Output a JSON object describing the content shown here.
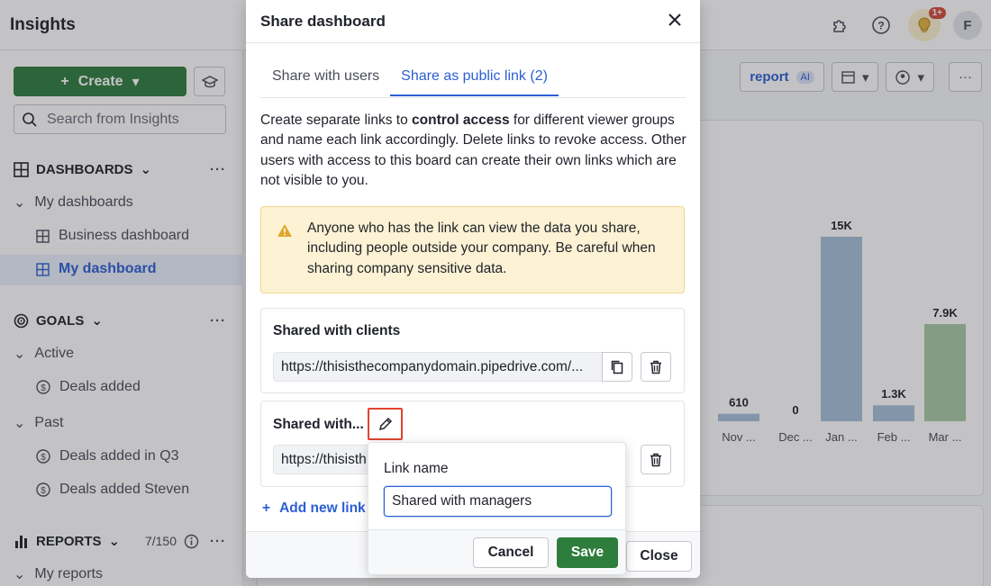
{
  "app": {
    "title": "Insights",
    "notification_badge": "1+",
    "user_initial": "F"
  },
  "sidebar": {
    "create_label": "Create",
    "search_placeholder": "Search from Insights",
    "dashboards": {
      "title": "DASHBOARDS",
      "group": "My dashboards",
      "items": [
        "Business dashboard",
        "My dashboard"
      ]
    },
    "goals": {
      "title": "GOALS",
      "active_group": "Active",
      "active_items": [
        "Deals added"
      ],
      "past_group": "Past",
      "past_items": [
        "Deals added in Q3",
        "Deals added Steven"
      ]
    },
    "reports": {
      "title": "REPORTS",
      "count": "7/150",
      "group": "My reports"
    }
  },
  "toolbar": {
    "report_label": "report",
    "ai_badge": "AI"
  },
  "chart_data": {
    "type": "bar",
    "categories": [
      "Nov ...",
      "Dec ...",
      "Jan ...",
      "Feb ...",
      "Mar ..."
    ],
    "values": [
      610,
      0,
      15000,
      1300,
      7900
    ],
    "data_labels": [
      "610",
      "0",
      "15K",
      "1.3K",
      "7.9K"
    ],
    "colors": [
      "#a7c0d9",
      "#a7c0d9",
      "#a7c0d9",
      "#a7c0d9",
      "#a9c9a6"
    ]
  },
  "modal": {
    "title": "Share dashboard",
    "tabs": [
      "Share with users",
      "Share as public link (2)"
    ],
    "description_parts": [
      "Create separate links to ",
      "control access",
      " for different viewer groups and name each link accordingly. Delete links to revoke access. Other users with access to this board can create their own links which are not visible to you."
    ],
    "warning": "Anyone who has the link can view the data you share, including people outside your company. Be careful when sharing company sensitive data.",
    "links": [
      {
        "name": "Shared with clients",
        "url": "https://thisisthecompanydomain.pipedrive.com/..."
      },
      {
        "name": "Shared with...",
        "url": "https://thisisth"
      }
    ],
    "add_link_label": "Add new link",
    "close_label": "Close"
  },
  "popover": {
    "label": "Link name",
    "value": "Shared with managers",
    "cancel_label": "Cancel",
    "save_label": "Save"
  },
  "colors": {
    "primary_green": "#2f7d3d",
    "link_blue": "#2c5fd3",
    "warning_bg": "#fdf3d4",
    "highlight_red": "#e0442f"
  }
}
